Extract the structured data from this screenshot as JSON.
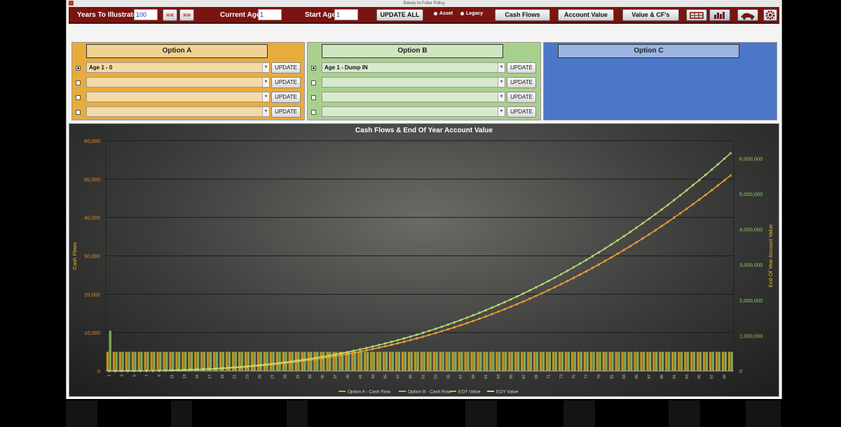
{
  "window": {
    "title": "Bakely to Fuller Policy"
  },
  "toolbar": {
    "years_label": "Years To Illustrate:",
    "years_value": "100",
    "prev_icon": "double-left-arrow-icon",
    "next_icon": "double-right-arrow-icon",
    "current_age_label": "Current Age:",
    "current_age_value": "1",
    "start_age_label": "Start Age:",
    "start_age_value": "1",
    "update_all": "UPDATE ALL",
    "radio_asset": "Asset",
    "radio_legacy": "Legacy",
    "cash_flows": "Cash Flows",
    "account_value": "Account Value",
    "value_cfs": "Value & CF's",
    "icons": [
      "table-icon",
      "bar-chart-icon",
      "car-icon",
      "gear-icon"
    ]
  },
  "panels": {
    "a": {
      "title": "Option A",
      "color": "#e8ac3c",
      "rows": [
        {
          "value": "Age 1 - 0",
          "checked": true
        },
        {
          "value": ""
        },
        {
          "value": ""
        },
        {
          "value": ""
        }
      ],
      "update": "UPDATE"
    },
    "b": {
      "title": "Option B",
      "color": "#a8d08d",
      "rows": [
        {
          "value": "Age 1 - Dump IN",
          "checked": true
        },
        {
          "value": ""
        },
        {
          "value": ""
        },
        {
          "value": ""
        }
      ],
      "update": "UPDATE"
    },
    "c": {
      "title": "Option C",
      "color": "#4b77c9"
    }
  },
  "chart_data": {
    "type": "bar+line",
    "title": "Cash Flows & End Of Year Account Value",
    "ylabel": "Cash Flows",
    "y2label": "End Of Year Account Value",
    "ylim": [
      0,
      60000
    ],
    "yticks": [
      "0",
      "10,000",
      "20,000",
      "30,000",
      "40,000",
      "50,000",
      "60,000"
    ],
    "y2lim": [
      0,
      6500000
    ],
    "y2ticks": [
      "0",
      "1,000,000",
      "2,000,000",
      "3,000,000",
      "4,000,000",
      "5,000,000",
      "6,000,000"
    ],
    "x_start": 1,
    "x_end": 100,
    "xtick_step": 2,
    "series": [
      {
        "name": "Option A - Cash Flow",
        "kind": "bar",
        "axis": "left",
        "color": "#e0a020",
        "first": 5000,
        "rest": 5000
      },
      {
        "name": "Option B - Cash Flow",
        "kind": "bar",
        "axis": "left",
        "color": "#8cc063",
        "first": 10500,
        "rest": 5000
      },
      {
        "name": "EOY Value",
        "kind": "line",
        "axis": "right",
        "color": "#f0a030",
        "final": 5520000,
        "exponent": 2.55
      },
      {
        "name": "EOY Value",
        "kind": "line",
        "axis": "right",
        "color": "#b8e070",
        "final": 6150000,
        "exponent": 2.55
      }
    ],
    "legend_position": "bottom"
  }
}
